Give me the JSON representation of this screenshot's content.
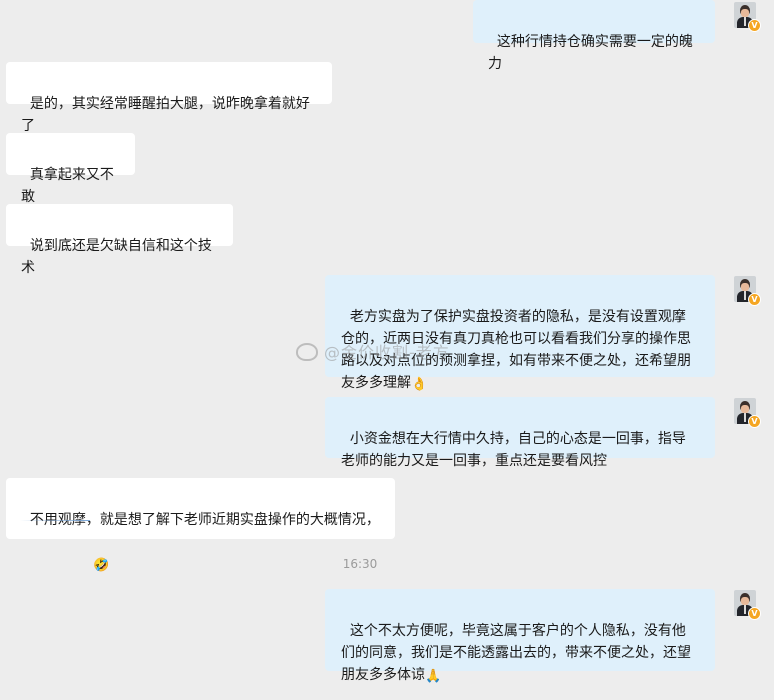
{
  "messages": [
    {
      "side": "right",
      "text": "这种行情持仓确实需要一定的魄力"
    },
    {
      "side": "left",
      "text": "是的，其实经常睡醒拍大腿，说昨晚拿着就好了"
    },
    {
      "side": "left",
      "text": "真拿起来又不敢"
    },
    {
      "side": "left",
      "text": "说到底还是欠缺自信和这个技术"
    },
    {
      "side": "right",
      "text": "老方实盘为了保护实盘投资者的隐私，是没有设置观摩仓的，近两日没有真刀真枪也可以看看我们分享的操作思路以及对点位的预测拿捏，如有带来不便之处，还希望朋友多多理解"
    },
    {
      "side": "right",
      "text": "小资金想在大行情中久持，自己的心态是一回事，指导老师的能力又是一回事，重点还是要看风控"
    },
    {
      "side": "left",
      "text": "不用观摩，就是想了解下老师近期实盘操作的大概情况，"
    },
    {
      "side": "right",
      "text": "这个不太方便呢，毕竟这属于客户的个人隐私，没有他们的同意，我们是不能透露出去的，带来不便之处，还望朋友多多体谅"
    }
  ],
  "timestamp": "16:30",
  "watermark": "@金价收割-老方",
  "emoji": {
    "ok_hand": "👌",
    "laugh_cry": "🤣",
    "pray": "🙏"
  },
  "avatar_badge": "V",
  "colors": {
    "background": "#ededed",
    "left_bubble": "#ffffff",
    "right_bubble": "#dff0fb",
    "badge": "#f5a623"
  }
}
